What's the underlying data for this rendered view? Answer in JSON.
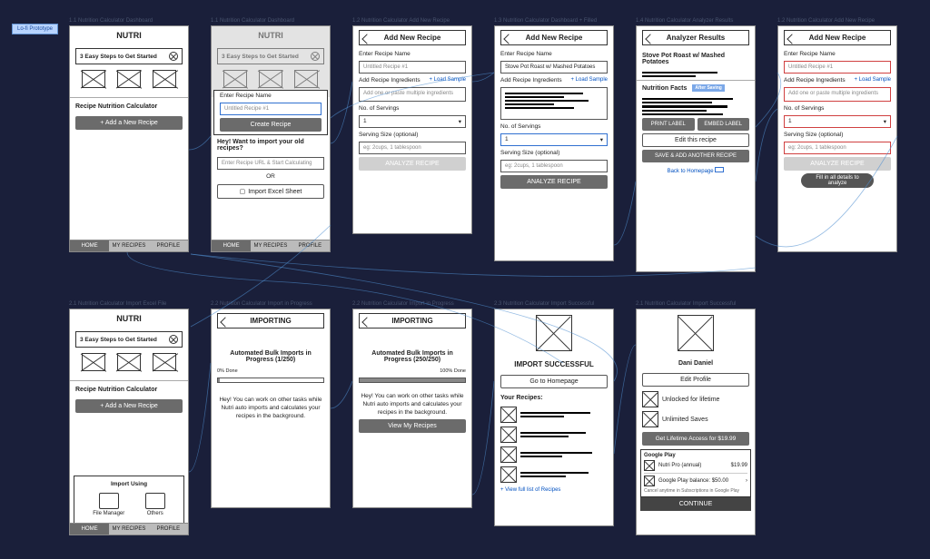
{
  "badge": "Lo-fi Prototype",
  "labels": {
    "f11": "1.1 Nutrition Calculator Dashboard",
    "f12": "1.1 Nutrition Calculator Dashboard",
    "f13": "1.2 Nutrition Calculator Add New Recipe",
    "f14": "1.3 Nutrition Calculator Dashboard + Filled",
    "f15": "1.4 Nutrition Calculator Analyzer Results",
    "f16": "1.2 Nutrition Calculator Add New Recipe",
    "f21": "2.1 Nutrition Calculator Import Excel File",
    "f22": "2.2 Nutrition Calculator Import in Progress",
    "f23": "2.2 Nutrition Calculator Import in Progress",
    "f24": "2.3 Nutrition Calculator Import Successful",
    "f25": "2.1 Nutrition Calculator Import Successful"
  },
  "c": {
    "brand": "NUTRI",
    "steps": "3 Easy Steps to Get Started",
    "calc": "Recipe Nutrition Calculator",
    "addBtn": "+  Add a New Recipe",
    "home": "HOME",
    "myrec": "MY RECIPES",
    "profile": "PROFILE",
    "enterName": "Enter Recipe Name",
    "untitled": "Untitled Recipe #1",
    "createRecipe": "Create Recipe",
    "importOld": "Hey! Want to import your old recipes?",
    "urlPlaceholder": "Enter Recipe URL & Start Calculating",
    "or": "OR",
    "importExcel": "Import Excel Sheet",
    "addNew": "Add New Recipe",
    "addIng": "Add Recipe Ingredients",
    "loadSample": "+ Load Sample",
    "ingPlaceholder": "Add one or paste multiple ingredients",
    "servings": "No. of Servings",
    "one": "1",
    "servSize": "Serving Size (optional)",
    "servPlaceholder": "eg: 2cups, 1 tablespoon",
    "analyze": "ANALYZE RECIPE",
    "recipeFilled": "Stove Pot Roast w/ Mashed Potatoes",
    "analyzer": "Analyzer Results",
    "recipeTitle": "Stove Pot Roast w/ Mashed Potatoes",
    "nutFacts": "Nutrition Facts",
    "afterSave": "After Saving",
    "printLabel": "PRINT LABEL",
    "embedLabel": "EMBED LABEL",
    "editRecipe": "Edit this recipe",
    "saveAnother": "SAVE & ADD ANOTHER RECIPE",
    "backHome": "Back to Homepage",
    "fillAll": "Fill in all details to analyze",
    "importing": "IMPORTING",
    "bulkProg1": "Automated Bulk Imports in Progress (1/250)",
    "bulkProg2": "Automated Bulk Imports in Progress (250/250)",
    "pct0": "0% Done",
    "pct100": "100% Done",
    "workMsg": "Hey! You can work on other tasks while Nutri auto imports and calculates your recipes in the background.",
    "viewRecipes": "View My Recipes",
    "importSuccess": "IMPORT SUCCESSFUL",
    "goHome": "Go to Homepage",
    "yourRecipes": "Your Recipes:",
    "viewFull": "+ View full list of Recipes",
    "dani": "Dani Daniel",
    "editProfile": "Edit Profile",
    "unlocked": "Unlocked for lifetime",
    "unlimited": "Unlimited Saves",
    "lifetime": "Get Lifetime Access for $19.99",
    "gplay": "Google Play",
    "nutriPro": "Nutri Pro (annual)",
    "price": "$19.99",
    "balance": "Google Play balance: $50.00",
    "cancelNote": "Cancel anytime in Subscriptions in Google Play",
    "continue": "CONTINUE",
    "importUsing": "Import Using",
    "fileMgr": "File Manager",
    "others": "Others"
  }
}
